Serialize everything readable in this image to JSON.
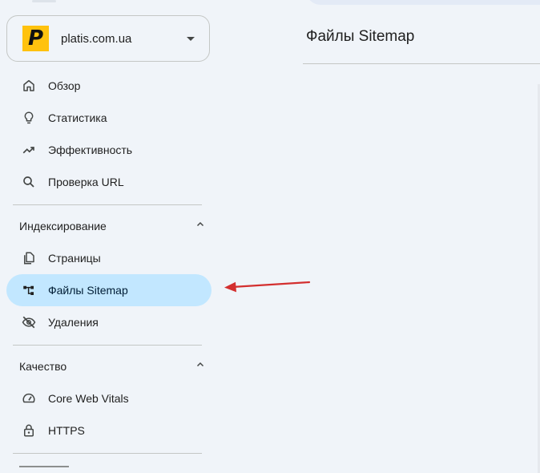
{
  "property": {
    "logo_letter": "P",
    "name": "platis.com.ua"
  },
  "nav": {
    "top_items": [
      {
        "label": "Обзор",
        "icon": "home-icon"
      },
      {
        "label": "Статистика",
        "icon": "lightbulb-icon"
      },
      {
        "label": "Эффективность",
        "icon": "trending-up-icon"
      },
      {
        "label": "Проверка URL",
        "icon": "search-icon"
      }
    ],
    "indexing": {
      "title": "Индексирование",
      "items": [
        {
          "label": "Страницы",
          "icon": "pages-icon"
        },
        {
          "label": "Файлы Sitemap",
          "icon": "sitemap-icon",
          "active": true
        },
        {
          "label": "Удаления",
          "icon": "visibility-off-icon"
        }
      ]
    },
    "quality": {
      "title": "Качество",
      "items": [
        {
          "label": "Core Web Vitals",
          "icon": "speed-icon"
        },
        {
          "label": "HTTPS",
          "icon": "lock-icon"
        }
      ]
    }
  },
  "main": {
    "title": "Файлы Sitemap"
  },
  "colors": {
    "background": "#f0f4f9",
    "active_item": "#c2e7ff",
    "annotation_arrow": "#d32f2f",
    "logo": "#ffc20e"
  }
}
